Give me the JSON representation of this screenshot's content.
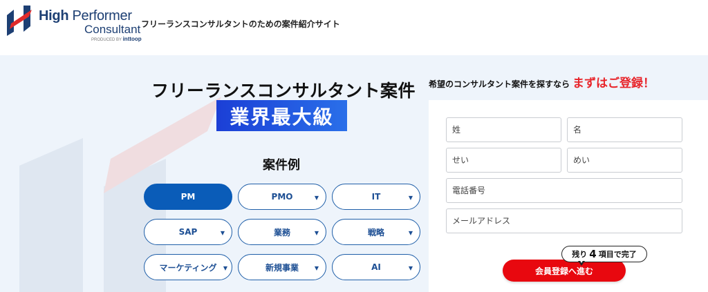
{
  "header": {
    "logo": {
      "line1_bold": "High",
      "line1_rest": "Performer",
      "line2": "Consultant",
      "line3_small": "PRODUCED BY",
      "line3_brand": "inttoop"
    },
    "tagline": "フリーランスコンサルタントのための案件紹介サイト"
  },
  "hero": {
    "title": "フリーランスコンサルタント案件",
    "badge": "業界最大級",
    "examples_heading": "案件例",
    "chips": [
      {
        "label": "PM",
        "active": true,
        "dropdown": false
      },
      {
        "label": "PMO",
        "active": false,
        "dropdown": true
      },
      {
        "label": "IT",
        "active": false,
        "dropdown": true
      },
      {
        "label": "SAP",
        "active": false,
        "dropdown": true
      },
      {
        "label": "業務",
        "active": false,
        "dropdown": true
      },
      {
        "label": "戦略",
        "active": false,
        "dropdown": true
      },
      {
        "label": "マーケティング",
        "active": false,
        "dropdown": true
      },
      {
        "label": "新規事業",
        "active": false,
        "dropdown": true
      },
      {
        "label": "AI",
        "active": false,
        "dropdown": true
      }
    ],
    "caret_glyph": "▼"
  },
  "registration": {
    "heading": "希望のコンサルタント案件を探すなら",
    "heading_accent": "まずはご登録！",
    "fields": {
      "last_name": {
        "placeholder": "姓",
        "value": ""
      },
      "first_name": {
        "placeholder": "名",
        "value": ""
      },
      "last_name_kana": {
        "placeholder": "せい",
        "value": ""
      },
      "first_name_kana": {
        "placeholder": "めい",
        "value": ""
      },
      "phone": {
        "placeholder": "電話番号",
        "value": ""
      },
      "email": {
        "placeholder": "メールアドレス",
        "value": ""
      }
    },
    "remaining": {
      "prefix": "残り",
      "count": "4",
      "suffix": "項目で完了"
    },
    "submit_label": "会員登録へ進む"
  },
  "colors": {
    "brand_navy": "#1d3f73",
    "accent_red": "#e8252b",
    "chip_blue": "#0a5cb8",
    "badge_blue": "#1b3fd6",
    "hero_bg": "#eef4fb"
  }
}
